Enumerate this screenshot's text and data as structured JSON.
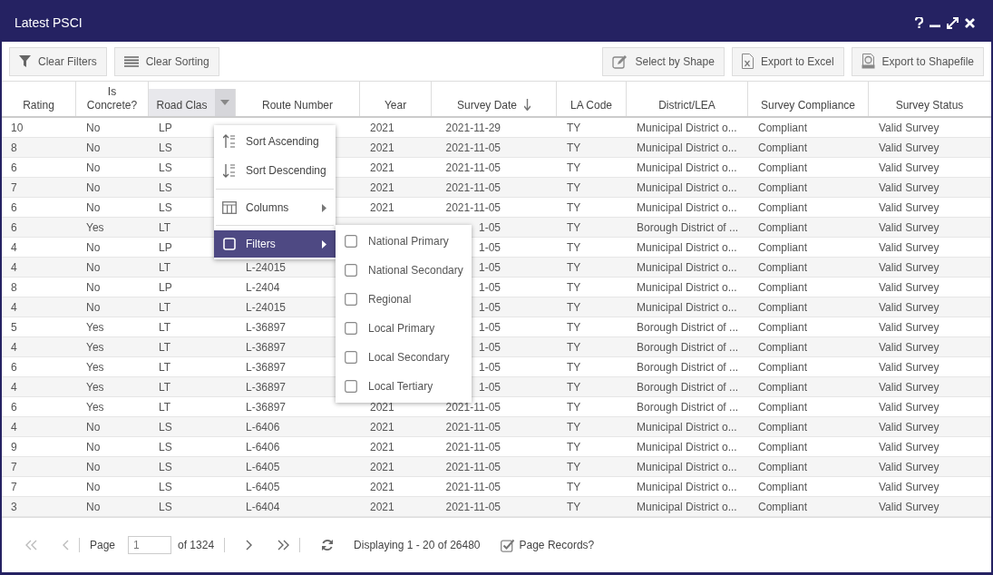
{
  "window": {
    "title": "Latest PSCI"
  },
  "toolbar": {
    "left": [
      {
        "kind": "filter",
        "label": "Clear Filters"
      },
      {
        "kind": "sort",
        "label": "Clear Sorting"
      }
    ],
    "right": [
      {
        "kind": "shape",
        "label": "Select by Shape"
      },
      {
        "kind": "excel",
        "label": "Export to Excel"
      },
      {
        "kind": "shapefile",
        "label": "Export to Shapefile"
      }
    ]
  },
  "table": {
    "columns": [
      {
        "label": "Rating"
      },
      {
        "label": "Is Concrete?"
      },
      {
        "label": "Road Clas",
        "menu_open": true
      },
      {
        "label": "Route Number"
      },
      {
        "label": "Year"
      },
      {
        "label": "Survey Date",
        "sorted_descending": true
      },
      {
        "label": "LA Code"
      },
      {
        "label": "District/LEA"
      },
      {
        "label": "Survey Compliance"
      },
      {
        "label": "Survey Status"
      }
    ],
    "rows": [
      {
        "rating": "10",
        "is_concrete": "No",
        "road_class": "LP",
        "year": "2021",
        "survey_date": "2021-11-29",
        "la_code": "TY",
        "district": "Municipal District o...",
        "compliance": "Compliant",
        "status": "Valid Survey"
      },
      {
        "rating": "8",
        "is_concrete": "No",
        "road_class": "LS",
        "year": "2021",
        "survey_date": "2021-11-05",
        "la_code": "TY",
        "district": "Municipal District o...",
        "compliance": "Compliant",
        "status": "Valid Survey"
      },
      {
        "rating": "6",
        "is_concrete": "No",
        "road_class": "LS",
        "year": "2021",
        "survey_date": "2021-11-05",
        "la_code": "TY",
        "district": "Municipal District o...",
        "compliance": "Compliant",
        "status": "Valid Survey"
      },
      {
        "rating": "7",
        "is_concrete": "No",
        "road_class": "LS",
        "year": "2021",
        "survey_date": "2021-11-05",
        "la_code": "TY",
        "district": "Municipal District o...",
        "compliance": "Compliant",
        "status": "Valid Survey"
      },
      {
        "rating": "6",
        "is_concrete": "No",
        "road_class": "LS",
        "year": "2021",
        "survey_date": "2021-11-05",
        "la_code": "TY",
        "district": "Municipal District o...",
        "compliance": "Compliant",
        "status": "Valid Survey"
      },
      {
        "rating": "6",
        "is_concrete": "Yes",
        "road_class": "LT",
        "survey_date": "1-05",
        "la_code": "TY",
        "district": "Borough District of ...",
        "compliance": "Compliant",
        "status": "Valid Survey"
      },
      {
        "rating": "4",
        "is_concrete": "No",
        "road_class": "LP",
        "survey_date": "1-05",
        "la_code": "TY",
        "district": "Municipal District o...",
        "compliance": "Compliant",
        "status": "Valid Survey"
      },
      {
        "rating": "4",
        "is_concrete": "No",
        "road_class": "LT",
        "route_number": "L-24015",
        "survey_date": "1-05",
        "la_code": "TY",
        "district": "Municipal District o...",
        "compliance": "Compliant",
        "status": "Valid Survey"
      },
      {
        "rating": "8",
        "is_concrete": "No",
        "road_class": "LP",
        "route_number": "L-2404",
        "survey_date": "1-05",
        "la_code": "TY",
        "district": "Municipal District o...",
        "compliance": "Compliant",
        "status": "Valid Survey"
      },
      {
        "rating": "4",
        "is_concrete": "No",
        "road_class": "LT",
        "route_number": "L-24015",
        "survey_date": "1-05",
        "la_code": "TY",
        "district": "Municipal District o...",
        "compliance": "Compliant",
        "status": "Valid Survey"
      },
      {
        "rating": "5",
        "is_concrete": "Yes",
        "road_class": "LT",
        "route_number": "L-36897",
        "survey_date": "1-05",
        "la_code": "TY",
        "district": "Borough District of ...",
        "compliance": "Compliant",
        "status": "Valid Survey"
      },
      {
        "rating": "4",
        "is_concrete": "Yes",
        "road_class": "LT",
        "route_number": "L-36897",
        "survey_date": "1-05",
        "la_code": "TY",
        "district": "Borough District of ...",
        "compliance": "Compliant",
        "status": "Valid Survey"
      },
      {
        "rating": "6",
        "is_concrete": "Yes",
        "road_class": "LT",
        "route_number": "L-36897",
        "survey_date": "1-05",
        "la_code": "TY",
        "district": "Borough District of ...",
        "compliance": "Compliant",
        "status": "Valid Survey"
      },
      {
        "rating": "4",
        "is_concrete": "Yes",
        "road_class": "LT",
        "route_number": "L-36897",
        "survey_date": "1-05",
        "la_code": "TY",
        "district": "Borough District of ...",
        "compliance": "Compliant",
        "status": "Valid Survey"
      },
      {
        "rating": "6",
        "is_concrete": "Yes",
        "road_class": "LT",
        "route_number": "L-36897",
        "year": "2021",
        "survey_date": "2021-11-05",
        "la_code": "TY",
        "district": "Borough District of ...",
        "compliance": "Compliant",
        "status": "Valid Survey"
      },
      {
        "rating": "4",
        "is_concrete": "No",
        "road_class": "LS",
        "route_number": "L-6406",
        "year": "2021",
        "survey_date": "2021-11-05",
        "la_code": "TY",
        "district": "Municipal District o...",
        "compliance": "Compliant",
        "status": "Valid Survey"
      },
      {
        "rating": "9",
        "is_concrete": "No",
        "road_class": "LS",
        "route_number": "L-6406",
        "year": "2021",
        "survey_date": "2021-11-05",
        "la_code": "TY",
        "district": "Municipal District o...",
        "compliance": "Compliant",
        "status": "Valid Survey"
      },
      {
        "rating": "7",
        "is_concrete": "No",
        "road_class": "LS",
        "route_number": "L-6405",
        "year": "2021",
        "survey_date": "2021-11-05",
        "la_code": "TY",
        "district": "Municipal District o...",
        "compliance": "Compliant",
        "status": "Valid Survey"
      },
      {
        "rating": "7",
        "is_concrete": "No",
        "road_class": "LS",
        "route_number": "L-6405",
        "year": "2021",
        "survey_date": "2021-11-05",
        "la_code": "TY",
        "district": "Municipal District o...",
        "compliance": "Compliant",
        "status": "Valid Survey"
      },
      {
        "rating": "3",
        "is_concrete": "No",
        "road_class": "LS",
        "route_number": "L-6404",
        "year": "2021",
        "survey_date": "2021-11-05",
        "la_code": "TY",
        "district": "Municipal District o...",
        "compliance": "Compliant",
        "status": "Valid Survey"
      }
    ]
  },
  "column_menu": {
    "items": [
      {
        "kind": "sort_asc",
        "label": "Sort Ascending",
        "selected": false
      },
      {
        "kind": "sort_desc",
        "label": "Sort Descending",
        "selected": false
      },
      {
        "kind": "columns",
        "label": "Columns",
        "selected": false
      },
      {
        "kind": "filters",
        "label": "Filters",
        "selected": true
      }
    ],
    "filters_submenu": [
      {
        "label": "National Primary",
        "checked": false
      },
      {
        "label": "National Secondary",
        "checked": false
      },
      {
        "label": "Regional",
        "checked": false
      },
      {
        "label": "Local Primary",
        "checked": false
      },
      {
        "label": "Local Secondary",
        "checked": false
      },
      {
        "label": "Local Tertiary",
        "checked": false
      }
    ]
  },
  "pager": {
    "page_label": "Page",
    "page": "1",
    "of_pages": "of 1324",
    "displaying": "Displaying 1 - 20 of 26480",
    "page_records": {
      "label": "Page Records?",
      "checked": true
    }
  }
}
